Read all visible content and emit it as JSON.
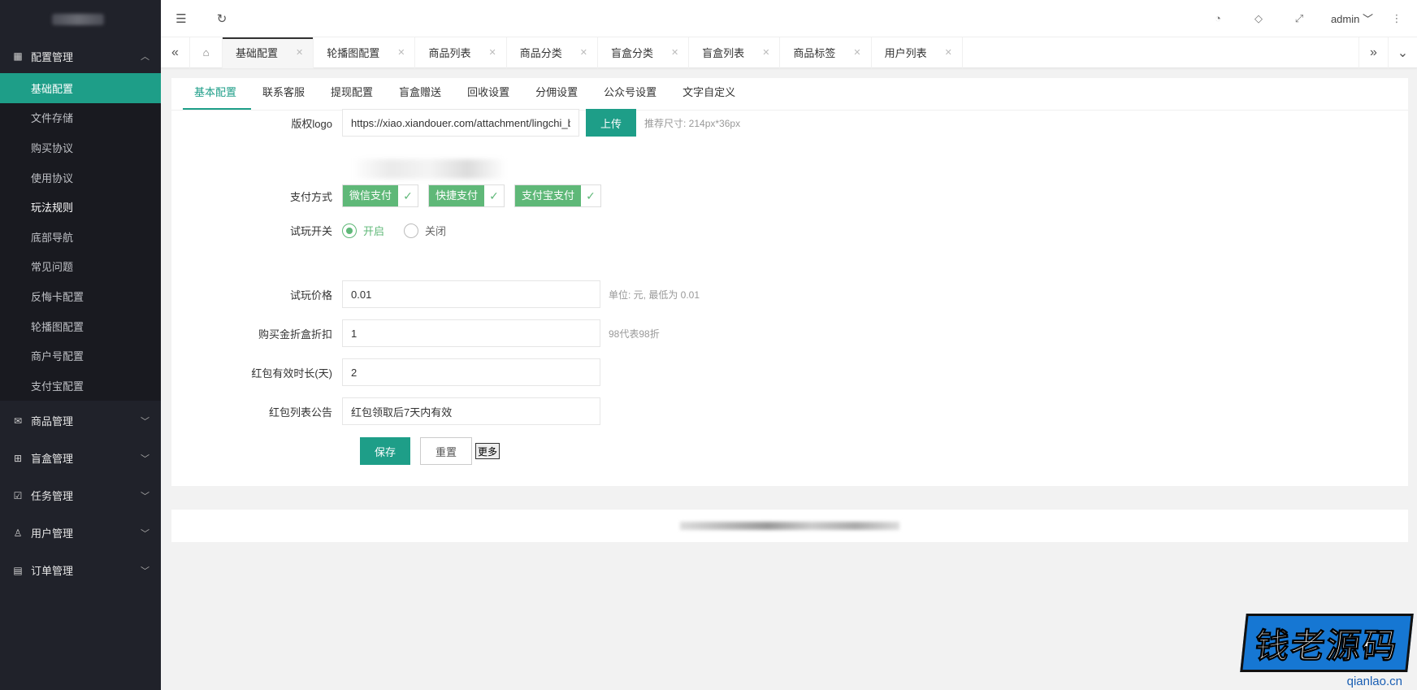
{
  "sidebar": {
    "groups": [
      {
        "label": "配置管理",
        "icon": "config-icon",
        "expanded": true
      },
      {
        "label": "商品管理",
        "icon": "goods-icon"
      },
      {
        "label": "盲盒管理",
        "icon": "gift-icon"
      },
      {
        "label": "任务管理",
        "icon": "task-icon"
      },
      {
        "label": "用户管理",
        "icon": "user-icon"
      },
      {
        "label": "订单管理",
        "icon": "order-icon"
      }
    ],
    "config_items": [
      "基础配置",
      "文件存储",
      "购买协议",
      "使用协议",
      "玩法规则",
      "底部导航",
      "常见问题",
      "反悔卡配置",
      "轮播图配置",
      "商户号配置",
      "支付宝配置"
    ]
  },
  "header": {
    "user": "admin"
  },
  "tabs": [
    "基础配置",
    "轮播图配置",
    "商品列表",
    "商品分类",
    "盲盒分类",
    "盲盒列表",
    "商品标签",
    "用户列表"
  ],
  "subtabs": [
    "基本配置",
    "联系客服",
    "提现配置",
    "盲盒赠送",
    "回收设置",
    "分佣设置",
    "公众号设置",
    "文字自定义"
  ],
  "form": {
    "logo": {
      "label": "版权logo",
      "value": "https://xiao.xiandouer.com/attachment/lingchi_blin",
      "upload": "上传",
      "hint": "推荐尺寸: 214px*36px"
    },
    "pay": {
      "label": "支付方式",
      "options": [
        "微信支付",
        "快捷支付",
        "支付宝支付"
      ]
    },
    "trial": {
      "label": "试玩开关",
      "on": "开启",
      "off": "关闭"
    },
    "trial_price": {
      "label": "试玩价格",
      "value": "0.01",
      "hint": "单位: 元, 最低为 0.01"
    },
    "discount": {
      "label": "购买金折盒折扣",
      "value": "1",
      "hint": "98代表98折"
    },
    "red_valid": {
      "label": "红包有效时长(天)",
      "value": "2"
    },
    "red_notice": {
      "label": "红包列表公告",
      "value": "红包领取后7天内有效"
    },
    "save": "保存",
    "reset": "重置",
    "more": "更多"
  },
  "watermark": {
    "title": "钱老源码",
    "site": "qianlao.cn"
  },
  "colors": {
    "accent": "#1e9e88",
    "check": "#5fb878",
    "sidebar": "#20222a"
  }
}
